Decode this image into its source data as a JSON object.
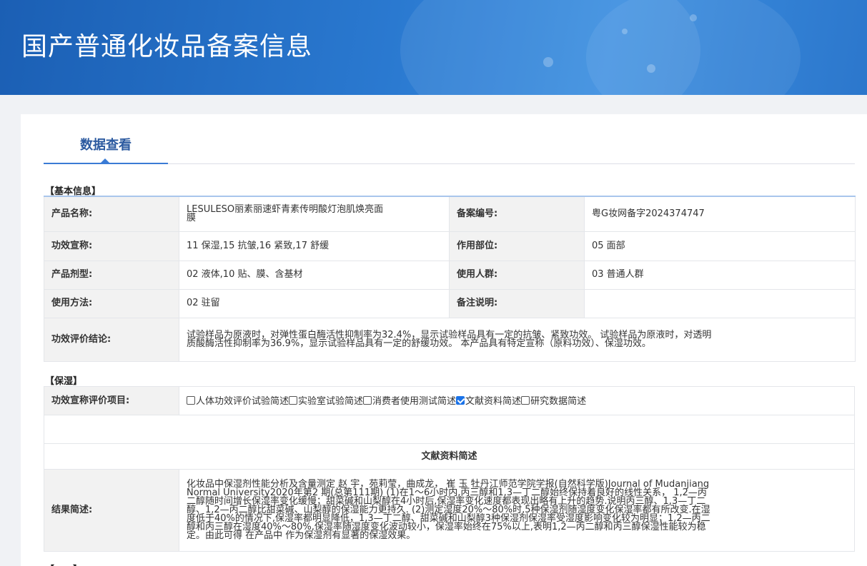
{
  "header": {
    "title": "国产普通化妆品备案信息"
  },
  "tabs": [
    {
      "label": "数据查看"
    }
  ],
  "basic_info": {
    "section_title": "【基本信息】",
    "product_name": {
      "label": "产品名称:",
      "value": "LESULESO丽素丽速虾青素传明酸灯泡肌焕亮面膜"
    },
    "record_number": {
      "label": "备案编号:",
      "value": "粤G妆网备字2024374747"
    },
    "efficacy_claim": {
      "label": "功效宣称:",
      "value": "11 保湿,15 抗皱,16 紧致,17 舒缓"
    },
    "application_area": {
      "label": "作用部位:",
      "value": "05 面部"
    },
    "dosage_form": {
      "label": "产品剂型:",
      "value": "02 液体,10 贴、膜、含基材"
    },
    "target_group": {
      "label": "使用人群:",
      "value": "03 普通人群"
    },
    "usage_method": {
      "label": "使用方法:",
      "value": "02 驻留"
    },
    "remarks": {
      "label": "备注说明:",
      "value": ""
    },
    "efficacy_conclusion": {
      "label": "功效评价结论:",
      "value": "试验样品为原液时，对弹性蛋白酶活性抑制率为32.4%，显示试验样品具有一定的抗皱、紧致功效。 试验样品为原液时，对透明质酸酶活性抑制率为36.9%，显示试验样品具有一定的舒缓功效。 本产品具有特定宣称（原料功效）、保湿功效。"
    }
  },
  "moisturizing": {
    "section_title": "【保湿】",
    "evaluation_items": {
      "label": "功效宣称评价项目:",
      "options": [
        {
          "label": "人体功效评价试验简述",
          "checked": false
        },
        {
          "label": "实验室试验简述",
          "checked": false
        },
        {
          "label": "消费者使用测试简述",
          "checked": false
        },
        {
          "label": "文献资料简述",
          "checked": true
        },
        {
          "label": "研究数据简述",
          "checked": false
        }
      ]
    },
    "subsection_title": "文献资料简述",
    "result": {
      "label": "结果简述:",
      "value": "化妆品中保湿剂性能分析及含量测定 赵 宇，苑莉莹，曲成龙， 崔 玉 牡丹江师范学院学报(自然科学版)Journal of Mudanjiang Normal University2020年第2 期(总第111期) (1)在1～6小时内,丙三醇和1,3—丁二醇始终保持着良好的线性关系， 1,2—丙二醇随时间增长保湿率变化缓慢；甜菜碱和山梨醇在4小时后,保湿率变化速度都表现出略有上升的趋势.说明丙三醇、1,3—丁二醇、1,2—丙二醇比甜菜碱、山梨醇的保湿能力更持久. (2)测定湿度20%～80%时,5种保湿剂随湿度变化保湿率都有所改变.在湿度低于40%的情况下,保湿率都明显降低，1,3—丁二醇、甜菜碱和山梨醇3种保湿剂保湿率受湿度影响变化较为明显；1,2—丙二醇和丙三醇在湿度40%～80%,保湿率随湿度变化波动较小，保湿率始终在75%以上,表明1,2—丙二醇和丙三醇保湿性能较为稳定。由此可得 在产品中 作为保湿剂有显著的保湿效果。"
    }
  },
  "next_section": {
    "title": "【……】"
  },
  "colors": {
    "banner": "#2a79d0",
    "tab_accent": "#3a7bd5",
    "checkbox_checked": "#1a73e8"
  }
}
